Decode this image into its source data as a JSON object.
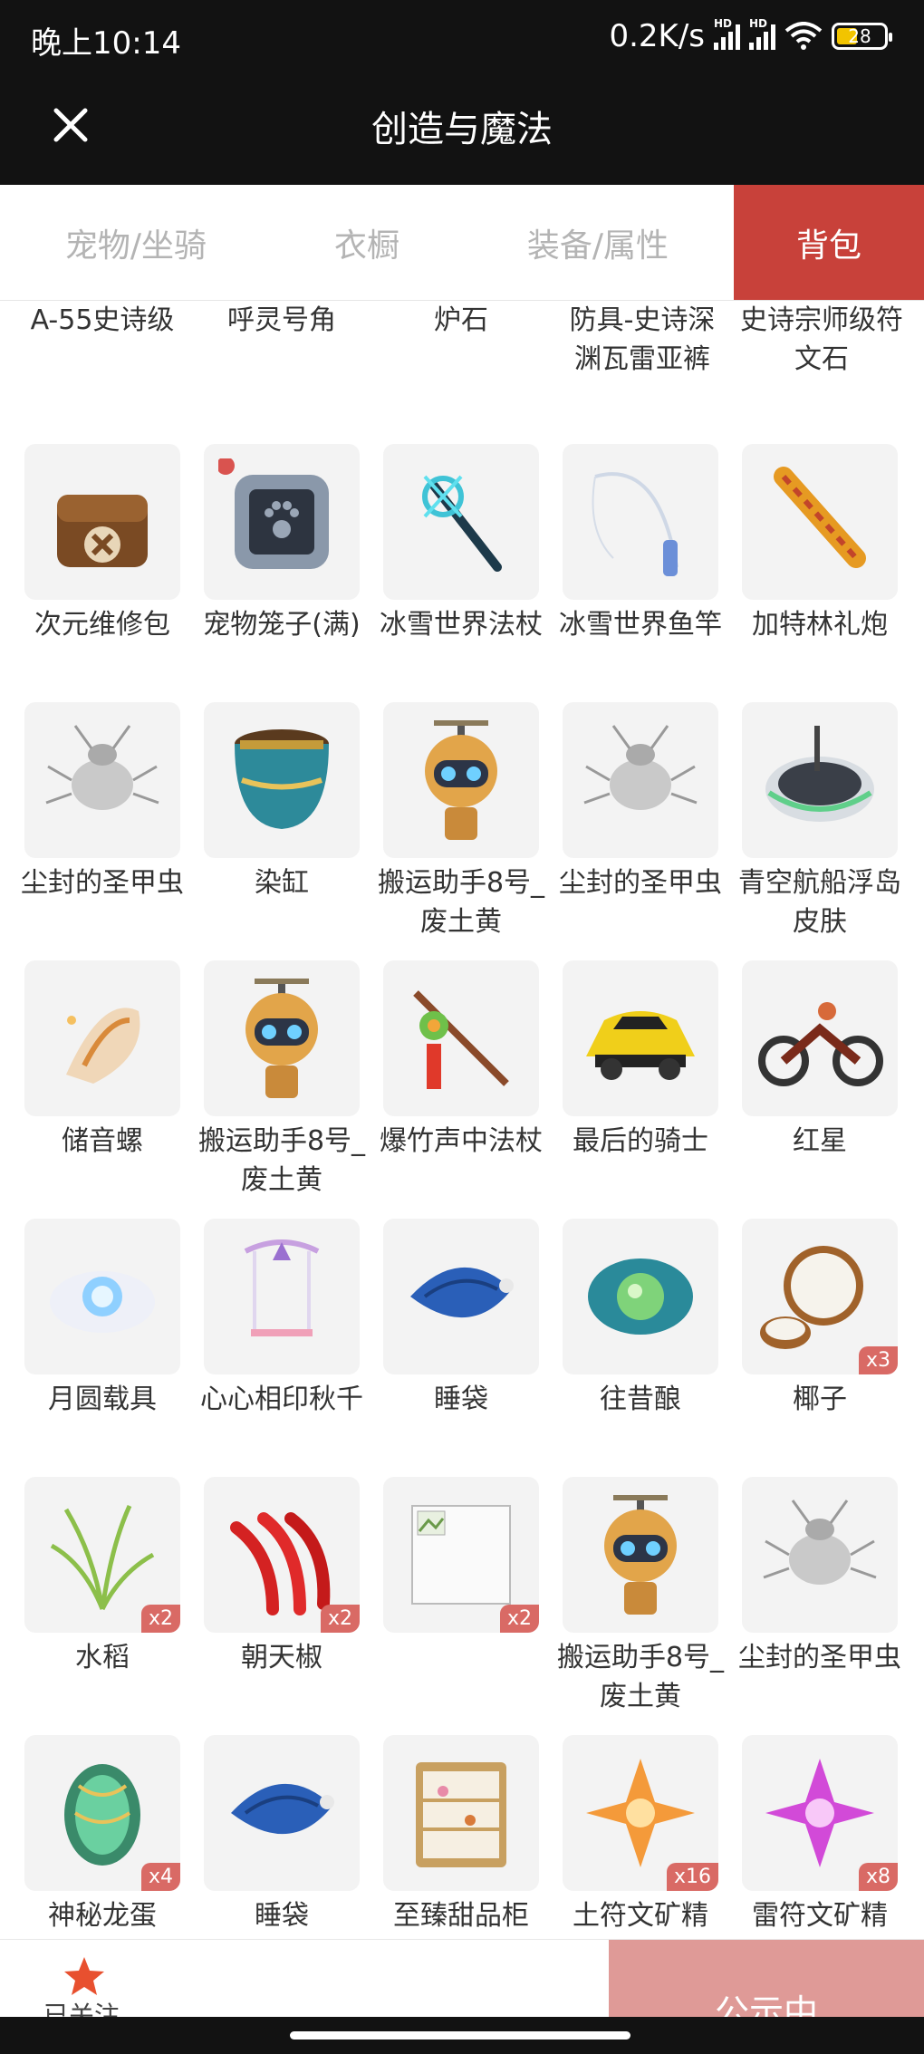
{
  "status": {
    "time": "晚上10:14",
    "speed": "0.2K/s",
    "battery": "28",
    "hd": "HD"
  },
  "header": {
    "title": "创造与魔法"
  },
  "tabs": [
    {
      "label": "宠物/坐骑"
    },
    {
      "label": "衣橱"
    },
    {
      "label": "装备/属性"
    },
    {
      "label": "背包"
    }
  ],
  "top_row": [
    {
      "label": "A-55史诗级"
    },
    {
      "label": "呼灵号角"
    },
    {
      "label": "炉石"
    },
    {
      "label": "防具-史诗深渊瓦雷亚裤"
    },
    {
      "label": "史诗宗师级符文石"
    }
  ],
  "items": [
    {
      "label": "次元维修包",
      "icon": "repair-bag-icon",
      "qty": ""
    },
    {
      "label": "宠物笼子(满)",
      "icon": "pet-cage-icon",
      "qty": ""
    },
    {
      "label": "冰雪世界法杖",
      "icon": "ice-staff-icon",
      "qty": ""
    },
    {
      "label": "冰雪世界鱼竿",
      "icon": "fishing-rod-icon",
      "qty": ""
    },
    {
      "label": "加特林礼炮",
      "icon": "gatling-cannon-icon",
      "qty": ""
    },
    {
      "label": "尘封的圣甲虫",
      "icon": "scarab-icon",
      "qty": ""
    },
    {
      "label": "染缸",
      "icon": "dye-vat-icon",
      "qty": ""
    },
    {
      "label": "搬运助手8号_废土黄",
      "icon": "robot-icon",
      "qty": ""
    },
    {
      "label": "尘封的圣甲虫",
      "icon": "scarab-icon",
      "qty": ""
    },
    {
      "label": "青空航船浮岛皮肤",
      "icon": "floating-island-icon",
      "qty": ""
    },
    {
      "label": "储音螺",
      "icon": "conch-icon",
      "qty": ""
    },
    {
      "label": "搬运助手8号_废土黄",
      "icon": "robot-icon",
      "qty": ""
    },
    {
      "label": "爆竹声中法杖",
      "icon": "firecracker-staff-icon",
      "qty": ""
    },
    {
      "label": "最后的骑士",
      "icon": "sports-car-icon",
      "qty": ""
    },
    {
      "label": "红星",
      "icon": "motorcycle-icon",
      "qty": ""
    },
    {
      "label": "月圆载具",
      "icon": "moon-cloud-icon",
      "qty": ""
    },
    {
      "label": "心心相印秋千",
      "icon": "swing-icon",
      "qty": ""
    },
    {
      "label": "睡袋",
      "icon": "sleeping-bag-icon",
      "qty": ""
    },
    {
      "label": "往昔酿",
      "icon": "past-brew-icon",
      "qty": ""
    },
    {
      "label": "椰子",
      "icon": "coconut-icon",
      "qty": "x3"
    },
    {
      "label": "水稻",
      "icon": "rice-icon",
      "qty": "x2"
    },
    {
      "label": "朝天椒",
      "icon": "chili-icon",
      "qty": "x2"
    },
    {
      "label": "",
      "icon": "broken-image-icon",
      "qty": "x2"
    },
    {
      "label": "搬运助手8号_废土黄",
      "icon": "robot-icon",
      "qty": ""
    },
    {
      "label": "尘封的圣甲虫",
      "icon": "scarab-icon",
      "qty": ""
    },
    {
      "label": "神秘龙蛋",
      "icon": "dragon-egg-icon",
      "qty": "x4"
    },
    {
      "label": "睡袋",
      "icon": "sleeping-bag-icon",
      "qty": ""
    },
    {
      "label": "至臻甜品柜",
      "icon": "dessert-cabinet-icon",
      "qty": ""
    },
    {
      "label": "土符文矿精",
      "icon": "earth-rune-crystal-icon",
      "qty": "x16"
    },
    {
      "label": "雷符文矿精",
      "icon": "thunder-rune-crystal-icon",
      "qty": "x8"
    }
  ],
  "bottom": {
    "fav_label": "已关注",
    "publish_label": "公示中"
  },
  "colors": {
    "accent": "#c8413a",
    "qty_badge": "#d96a65",
    "publish": "#df9a97",
    "header": "#121212"
  }
}
